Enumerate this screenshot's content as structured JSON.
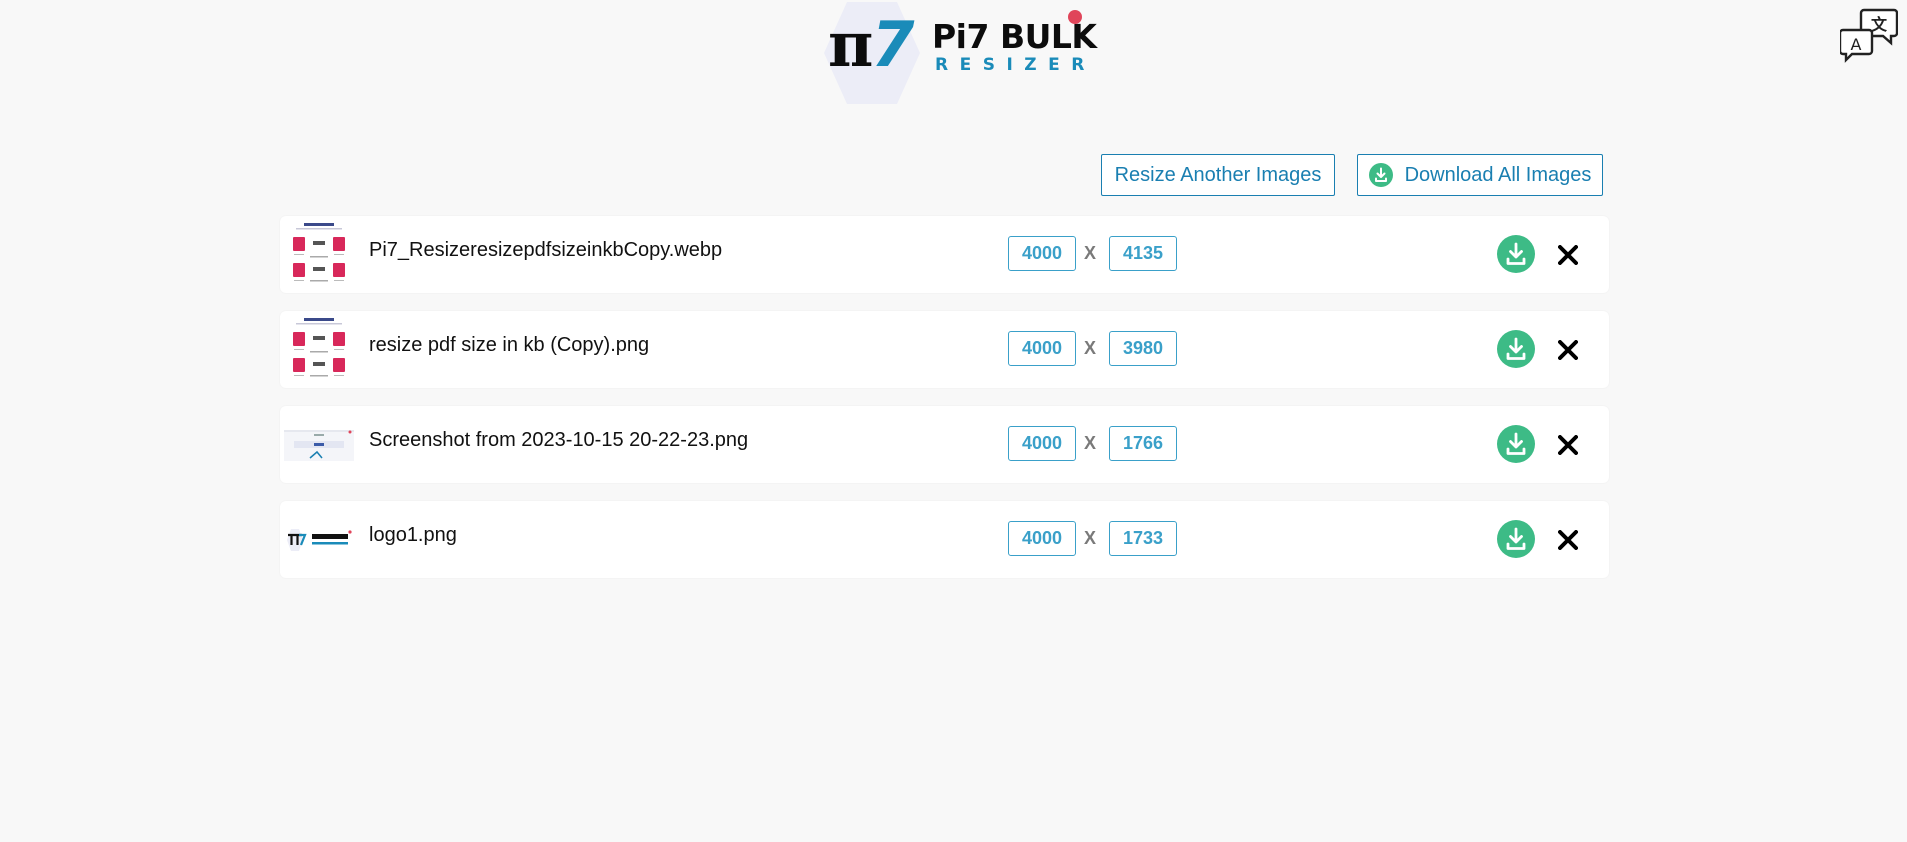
{
  "header": {
    "logo_pi": "π",
    "logo_seven": "7",
    "logo_title": "Pi7 BULK",
    "logo_subtitle": "RESIZER"
  },
  "actions": {
    "resize_another_label": "Resize Another Images",
    "download_all_label": "Download All Images"
  },
  "separator": "X",
  "colors": {
    "accent": "#1a7fb1",
    "download_green": "#3dbb86",
    "dimension_blue": "#3aa0c9",
    "background": "#f8f8f8"
  },
  "files": [
    {
      "name": "Pi7_ResizeresizepdfsizeinkbCopy.webp",
      "width": "4000",
      "height": "4135",
      "thumb": "pdf-grid-thumbnail"
    },
    {
      "name": "resize pdf size in kb (Copy).png",
      "width": "4000",
      "height": "3980",
      "thumb": "pdf-grid-thumbnail"
    },
    {
      "name": "Screenshot from 2023-10-15 20-22-23.png",
      "width": "4000",
      "height": "1766",
      "thumb": "screenshot-thumbnail"
    },
    {
      "name": "logo1.png",
      "width": "4000",
      "height": "1733",
      "thumb": "logo-thumbnail"
    }
  ]
}
